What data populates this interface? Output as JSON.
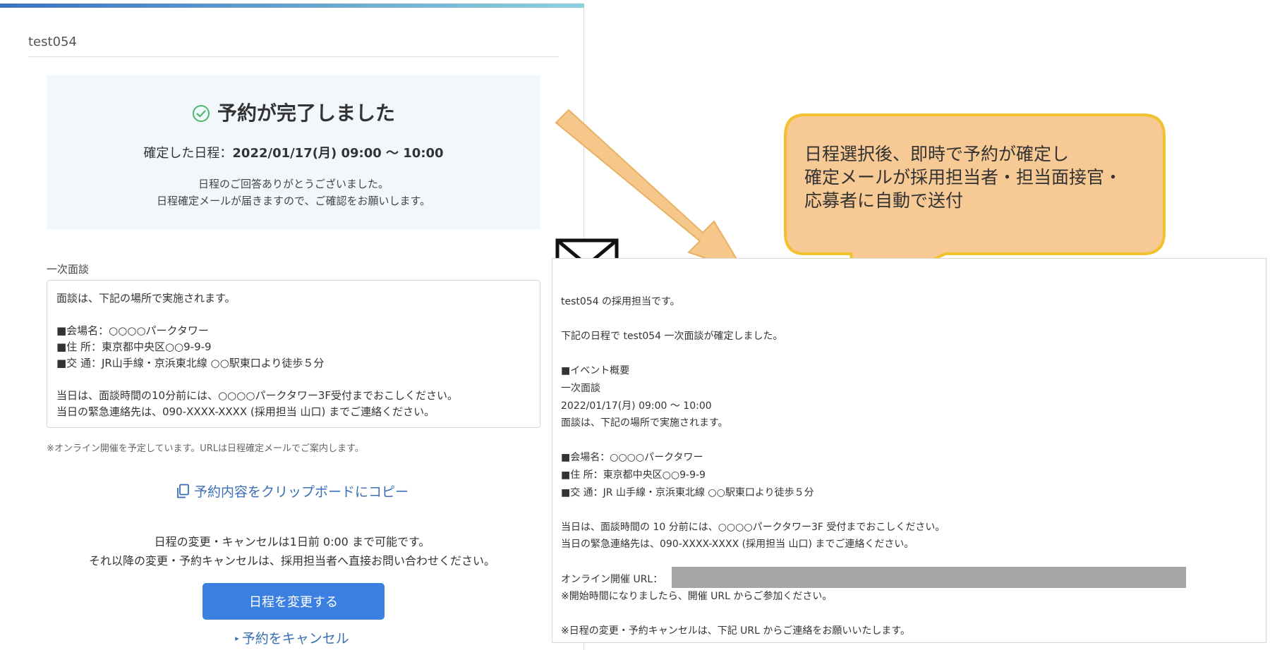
{
  "booking": {
    "event_title": "test054",
    "complete_heading": "予約が完了しました",
    "confirmed_label": "確定した日程：",
    "confirmed_datetime": "2022/01/17(月) 09:00 ～ 10:00",
    "thanks_line1": "日程のご回答ありがとうございました。",
    "thanks_line2": "日程確定メールが届きますので、ご確認をお願いします。",
    "section_label": "一次面談",
    "details": {
      "line1": "面談は、下記の場所で実施されます。",
      "venue": "■会場名：○○○○パークタワー",
      "address": "■住 所：東京都中央区○○9-9-9",
      "access": "■交 通：JR山手線・京浜東北線 ○○駅東口より徒歩５分",
      "arrival": "当日は、面談時間の10分前には、○○○○パークタワー3F受付までおこしください。",
      "emergency": "当日の緊急連絡先は、090-XXXX-XXXX (採用担当 山口) までご連絡ください。"
    },
    "online_note": "※オンライン開催を予定しています。URLは日程確定メールでご案内します。",
    "copy_label": "予約内容をクリップボードにコピー",
    "change_note1": "日程の変更・キャンセルは1日前 0:00 まで可能です。",
    "change_note2": "それ以降の変更・予約キャンセルは、採用担当者へ直接お問い合わせください。",
    "change_button_label": "日程を変更する",
    "cancel_label": "予約をキャンセル"
  },
  "callout": {
    "line1": "日程選択後、即時で予約が確定し",
    "line2": "確定メールが採用担当者・担当面接官・",
    "line3": "応募者に自動で送付"
  },
  "email": {
    "greeting": "test054 の採用担当です。",
    "intro": "下記の日程で test054 一次面談が確定しました。",
    "overview_header": "■イベント概要",
    "event_name": "一次面談",
    "datetime": "2022/01/17(月) 09:00 ～ 10:00",
    "location_intro": "面談は、下記の場所で実施されます。",
    "venue": "■会場名：○○○○パークタワー",
    "address": "■住 所：東京都中央区○○9-9-9",
    "access": "■交 通：JR 山手線・京浜東北線 ○○駅東口より徒歩５分",
    "arrival": "当日は、面談時間の 10 分前には、○○○○パークタワー3F 受付までおこしください。",
    "emergency": "当日の緊急連絡先は、090-XXXX-XXXX (採用担当 山口) までご連絡ください。",
    "online_url_label": "オンライン開催 URL：",
    "join_note": "※開始時間になりましたら、開催 URL からご参加ください。",
    "change_note": "※日程の変更・予約キャンセルは、下記 URL からご連絡をお願いいたします。"
  },
  "colors": {
    "accent_blue": "#3b7fe0",
    "link_blue": "#3a6fb5",
    "complete_bg": "#f2f7fc",
    "check_green": "#4cb86a",
    "arrow_fill": "#f6c78a",
    "callout_fill": "#f7c995",
    "callout_border": "#f2c12e"
  },
  "icons": [
    "check-circle-icon",
    "copy-icon",
    "envelope-icon",
    "arrow-icon"
  ]
}
